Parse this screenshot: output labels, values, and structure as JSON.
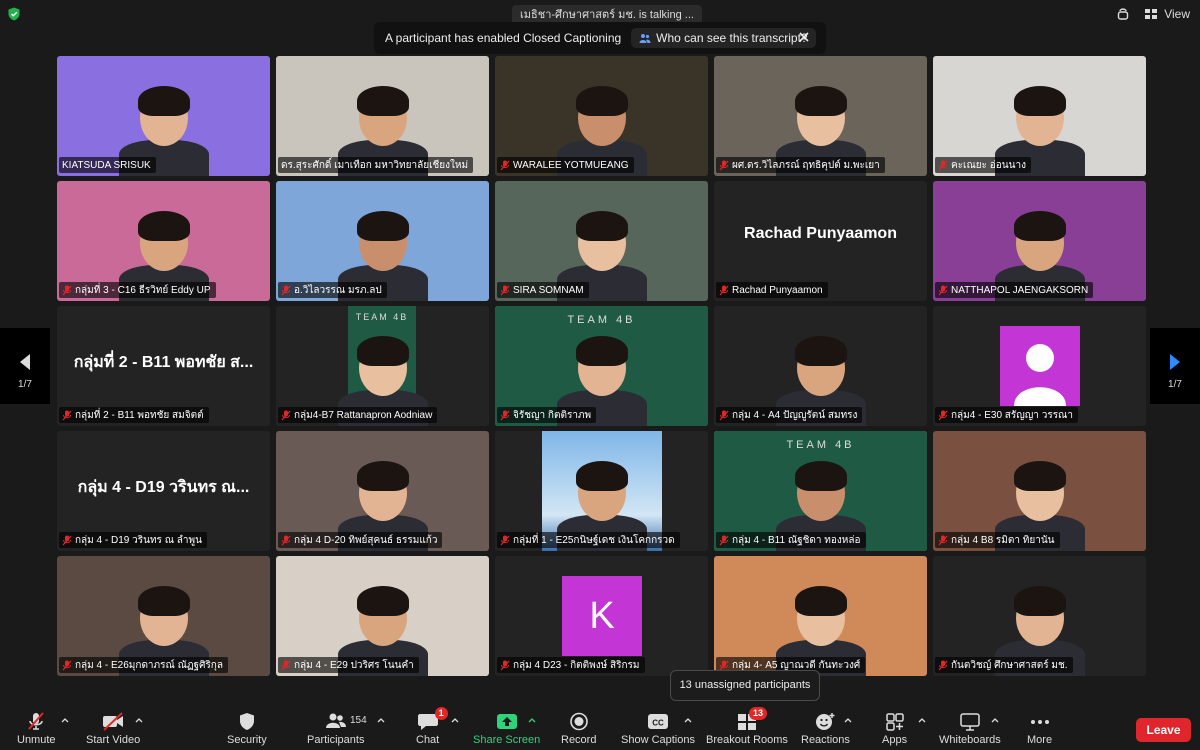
{
  "top": {
    "talking": "เมธิชา-ศึกษาศาสตร์ มช. is talking ...",
    "view_label": "View"
  },
  "caption_banner": {
    "message": "A participant has enabled Closed Captioning",
    "who_link": "Who can see this transcript?"
  },
  "pager": {
    "left": "1/7",
    "right": "1/7"
  },
  "tiles": [
    {
      "name": "KIATSUDA SRISUK",
      "muted": false,
      "bg": "#8a6fe0"
    },
    {
      "name": "ดร.สุระศักดิ์ เมาเทือก มหาวิทยาลัยเชียงใหม่",
      "muted": false,
      "bg": "#c9c4bc"
    },
    {
      "name": "WARALEE YOTMUEANG",
      "muted": true,
      "bg": "#3a3428"
    },
    {
      "name": "ผศ.ดร.วิไลภรณ์ ฤทธิคุปต์ ม.พะเยา",
      "muted": true,
      "bg": "#6b645a"
    },
    {
      "name": "คะเณยะ อ่อนนาง",
      "muted": true,
      "bg": "#d8d6d2"
    },
    {
      "name": "กลุ่มที่ 3 - C16 ธีรวิทย์ Eddy UP",
      "muted": true,
      "bg": "#c96a98"
    },
    {
      "name": "อ.วิไลวรรณ มรภ.ลป",
      "muted": true,
      "bg": "#7fa6d8"
    },
    {
      "name": "SIRA SOMNAM",
      "muted": true,
      "bg": "#56665a"
    },
    {
      "name": "Rachad Punyaamon",
      "muted": true,
      "bg": "#232323",
      "big": "Rachad Punyaamon"
    },
    {
      "name": "NATTHAPOL JAENGAKSORN",
      "muted": true,
      "bg": "#8a3f96"
    },
    {
      "name": "กลุ่มที่ 2 - B11 พอทชัย สมจิตต์",
      "muted": true,
      "bg": "#232323",
      "big": "กลุ่มที่ 2 - B11 พอทชัย ส..."
    },
    {
      "name": "กลุ่ม4-B7 Rattanapron Aodniaw",
      "muted": true,
      "bg": "#232323",
      "inset": true,
      "inset_text": "TEAM 4B"
    },
    {
      "name": "จิรัชญา กิตติราภพ",
      "muted": true,
      "bg": "#1f5a45",
      "active": true,
      "team": "TEAM 4B"
    },
    {
      "name": "กลุ่ม 4 - A4 ปัญญูรัตน์ สมทรง",
      "muted": true,
      "bg": "#232323"
    },
    {
      "name": "กลุ่ม4 - E30 สรัญญา วรรณา",
      "muted": true,
      "bg": "#232323",
      "avatar": true
    },
    {
      "name": "กลุ่ม 4 - D19 วรินทร ณ ลำพูน",
      "muted": true,
      "bg": "#232323",
      "big": "กลุ่ม 4 - D19 วรินทร ณ..."
    },
    {
      "name": "กลุ่ม 4 D-20 ทิพย์สุคนธ์ ธรรมแก้ว",
      "muted": true,
      "bg": "#6a5a55"
    },
    {
      "name": "กลุ่มที่ 1 - E25กนิษฐ์เดช เงินโคกกรวด",
      "muted": true,
      "bg": "#232323",
      "sky": true
    },
    {
      "name": "กลุ่ม 4 - B11 ณัฐชิดา ทองหล่อ",
      "muted": true,
      "bg": "#1f5a45",
      "active": true,
      "team": "TEAM 4B"
    },
    {
      "name": "กลุ่ม 4 B8 รมิตา ทิยานัน",
      "muted": true,
      "bg": "#7a5040"
    },
    {
      "name": "กลุ่ม 4 - E26มุกดาภรณ์ ณัฏฐศิริกุล",
      "muted": true,
      "bg": "#5a4a42"
    },
    {
      "name": "กลุ่ม 4 - E29 ปวริศร โนนคำ",
      "muted": true,
      "bg": "#d8d0c6"
    },
    {
      "name": "กลุ่ม 4 D23 - กิตติพงษ์ สิริกรม",
      "muted": true,
      "bg": "#232323",
      "letter": "K"
    },
    {
      "name": "กลุ่ม 4- A5 ญาณวดี กันทะวงศ์",
      "muted": true,
      "bg": "#d08a5a"
    },
    {
      "name": "กันตวิชญ์ ศึกษาศาสตร์ มช.",
      "muted": true,
      "bg": "#232323"
    }
  ],
  "tooltip": "13 unassigned participants",
  "toolbar": {
    "unmute": "Unmute",
    "start_video": "Start Video",
    "security": "Security",
    "participants": "Participants",
    "participants_count": "154",
    "chat": "Chat",
    "chat_badge": "1",
    "share_screen": "Share Screen",
    "record": "Record",
    "show_captions": "Show Captions",
    "breakout_rooms": "Breakout Rooms",
    "breakout_badge": "13",
    "reactions": "Reactions",
    "apps": "Apps",
    "whiteboards": "Whiteboards",
    "more": "More",
    "leave": "Leave"
  },
  "colors": {
    "accent_green": "#2fd37a",
    "leave_red": "#e0262d",
    "active_speaker": "#c9c12f",
    "badge_red": "#e02828"
  }
}
